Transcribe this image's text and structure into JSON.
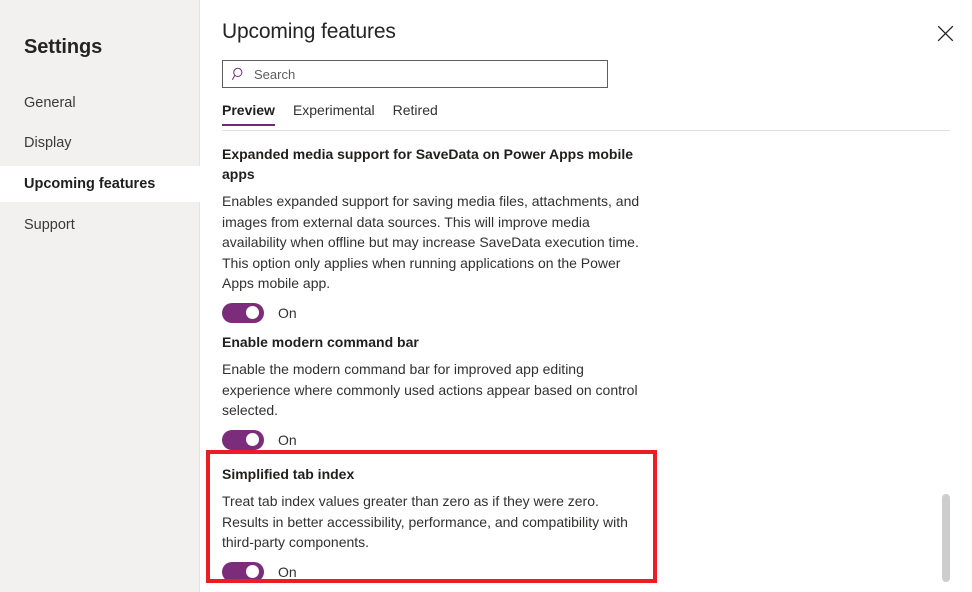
{
  "sidebar": {
    "title": "Settings",
    "items": [
      {
        "label": "General",
        "selected": false
      },
      {
        "label": "Display",
        "selected": false
      },
      {
        "label": "Upcoming features",
        "selected": true
      },
      {
        "label": "Support",
        "selected": false
      }
    ]
  },
  "header": {
    "title": "Upcoming features",
    "close_icon": "close-icon"
  },
  "search": {
    "icon": "search-icon",
    "value": "",
    "placeholder": "Search"
  },
  "tabs": [
    {
      "label": "Preview",
      "active": true
    },
    {
      "label": "Experimental",
      "active": false
    },
    {
      "label": "Retired",
      "active": false
    }
  ],
  "features": [
    {
      "title": "Expanded media support for SaveData on Power Apps mobile apps",
      "description": "Enables expanded support for saving media files, attachments, and images from external data sources. This will improve media availability when offline but may increase SaveData execution time. This option only applies when running applications on the Power Apps mobile app.",
      "toggle_state": "On",
      "toggle_on": true
    },
    {
      "title": "Enable modern command bar",
      "description": "Enable the modern command bar for improved app editing experience where commonly used actions appear based on control selected.",
      "toggle_state": "On",
      "toggle_on": true
    },
    {
      "title": "Simplified tab index",
      "description": "Treat tab index values greater than zero as if they were zero. Results in better accessibility, performance, and compatibility with third-party components.",
      "toggle_state": "On",
      "toggle_on": true,
      "highlighted": true
    }
  ],
  "colors": {
    "accent_purple": "#742774",
    "toggle_purple": "#7b2d7b",
    "highlight_red": "#ec1c24",
    "sidebar_bg": "#f2f1f0",
    "scrollbar_thumb": "#cdcdcd"
  }
}
